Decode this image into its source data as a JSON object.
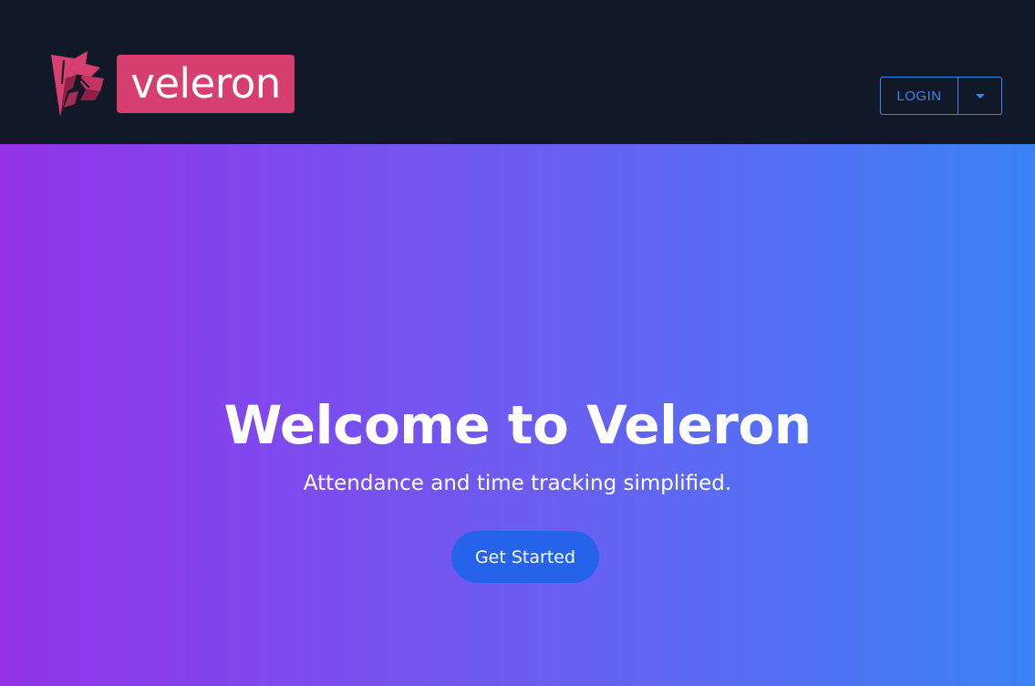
{
  "header": {
    "logo_text": "veleron",
    "login_label": "LOGIN",
    "login_dropdown_icon": "caret-down-icon"
  },
  "hero": {
    "title": "Welcome to Veleron",
    "subtitle": "Attendance and time tracking simplified.",
    "cta_label": "Get Started"
  },
  "colors": {
    "header_bg": "#111827",
    "logo_badge": "#d63f70",
    "accent": "#3b82f6",
    "cta_bg": "#2563eb",
    "gradient_start": "#9333ea",
    "gradient_end": "#3b82f6"
  }
}
